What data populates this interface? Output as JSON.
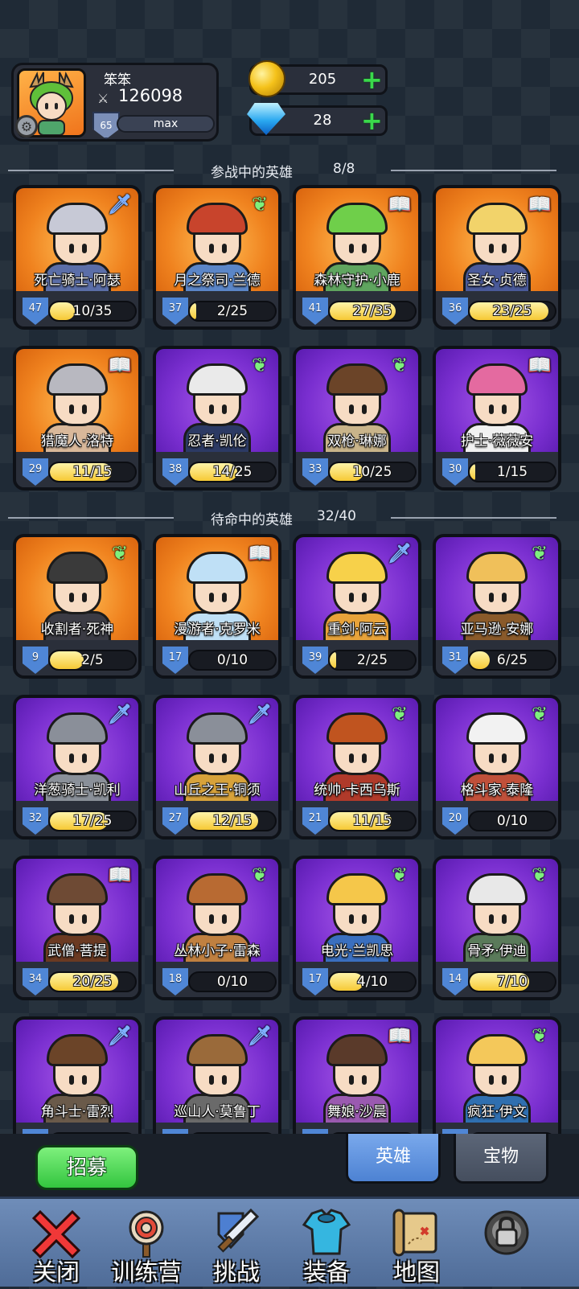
{
  "player": {
    "name": "笨笨",
    "power": "126098",
    "level": "65",
    "level_status": "max"
  },
  "currency": {
    "gold": "205",
    "gems": "28"
  },
  "active_section": {
    "title": "参战中的英雄",
    "count": "8/8"
  },
  "standby_section": {
    "title": "待命中的英雄",
    "count": "32/40"
  },
  "active_heroes": [
    {
      "name": "死亡骑士·阿瑟",
      "level": "47",
      "progress": "10/35",
      "fill": 0.29,
      "bg": "orange",
      "class_icon": "sword-icon"
    },
    {
      "name": "月之祭司·兰德",
      "level": "37",
      "progress": "2/25",
      "fill": 0.08,
      "bg": "orange",
      "class_icon": "wing-icon"
    },
    {
      "name": "森林守护·小鹿",
      "level": "41",
      "progress": "27/35",
      "fill": 0.77,
      "bg": "orange",
      "class_icon": "book-icon"
    },
    {
      "name": "圣女·贞德",
      "level": "36",
      "progress": "23/25",
      "fill": 0.92,
      "bg": "orange",
      "class_icon": "book-icon"
    },
    {
      "name": "猎魔人·洛特",
      "level": "29",
      "progress": "11/15",
      "fill": 0.73,
      "bg": "orange",
      "class_icon": "book-icon"
    },
    {
      "name": "忍者·凯伦",
      "level": "38",
      "progress": "14/25",
      "fill": 0.56,
      "bg": "purple",
      "class_icon": "wing-icon"
    },
    {
      "name": "双枪·琳娜",
      "level": "33",
      "progress": "10/25",
      "fill": 0.4,
      "bg": "purple",
      "class_icon": "wing-icon"
    },
    {
      "name": "护士·薇薇安",
      "level": "30",
      "progress": "1/15",
      "fill": 0.07,
      "bg": "purple",
      "class_icon": "book-icon"
    }
  ],
  "standby_heroes": [
    {
      "name": "收割者·死神",
      "level": "9",
      "progress": "2/5",
      "fill": 0.4,
      "bg": "orange",
      "class_icon": "wing-icon"
    },
    {
      "name": "漫游者·克罗米",
      "level": "17",
      "progress": "0/10",
      "fill": 0.0,
      "bg": "orange",
      "class_icon": "book-icon"
    },
    {
      "name": "重剑·阿云",
      "level": "39",
      "progress": "2/25",
      "fill": 0.08,
      "bg": "purple",
      "class_icon": "sword-icon"
    },
    {
      "name": "亚马逊·安娜",
      "level": "31",
      "progress": "6/25",
      "fill": 0.24,
      "bg": "purple",
      "class_icon": "wing-icon"
    },
    {
      "name": "洋葱骑士·凯利",
      "level": "32",
      "progress": "17/25",
      "fill": 0.68,
      "bg": "purple",
      "class_icon": "sword-icon"
    },
    {
      "name": "山丘之王·铜须",
      "level": "27",
      "progress": "12/15",
      "fill": 0.8,
      "bg": "purple",
      "class_icon": "sword-icon"
    },
    {
      "name": "统帅·卡西乌斯",
      "level": "21",
      "progress": "11/15",
      "fill": 0.73,
      "bg": "purple",
      "class_icon": "wing-icon"
    },
    {
      "name": "格斗家·泰隆",
      "level": "20",
      "progress": "0/10",
      "fill": 0.0,
      "bg": "purple",
      "class_icon": "wing-icon"
    },
    {
      "name": "武僧·菩提",
      "level": "34",
      "progress": "20/25",
      "fill": 0.8,
      "bg": "purple",
      "class_icon": "book-icon"
    },
    {
      "name": "丛林小子·雷森",
      "level": "18",
      "progress": "0/10",
      "fill": 0.0,
      "bg": "purple",
      "class_icon": "wing-icon"
    },
    {
      "name": "电光·兰凯思",
      "level": "17",
      "progress": "4/10",
      "fill": 0.4,
      "bg": "purple",
      "class_icon": "wing-icon"
    },
    {
      "name": "骨矛·伊迪",
      "level": "14",
      "progress": "7/10",
      "fill": 0.7,
      "bg": "purple",
      "class_icon": "wing-icon"
    },
    {
      "name": "角斗士·雷烈",
      "level": "",
      "progress": "",
      "fill": 0.0,
      "bg": "purple",
      "class_icon": "sword-icon"
    },
    {
      "name": "巡山人·莫鲁丁",
      "level": "",
      "progress": "",
      "fill": 0.0,
      "bg": "purple",
      "class_icon": "sword-icon"
    },
    {
      "name": "舞娘·沙晨",
      "level": "",
      "progress": "",
      "fill": 0.0,
      "bg": "purple",
      "class_icon": "book-icon"
    },
    {
      "name": "疯狂·伊文",
      "level": "",
      "progress": "",
      "fill": 0.0,
      "bg": "purple",
      "class_icon": "wing-icon"
    }
  ],
  "actions": {
    "recruit": "招募",
    "tab_heroes": "英雄",
    "tab_treasure": "宝物"
  },
  "nav": [
    {
      "label": "关闭",
      "icon": "close-icon",
      "selected": true
    },
    {
      "label": "训练营",
      "icon": "target-icon",
      "selected": false
    },
    {
      "label": "挑战",
      "icon": "sword-shield-icon",
      "selected": false
    },
    {
      "label": "装备",
      "icon": "armor-icon",
      "selected": false
    },
    {
      "label": "地图",
      "icon": "map-icon",
      "selected": false
    },
    {
      "label": "",
      "icon": "locked-icon",
      "selected": false
    }
  ],
  "colors": {
    "orange_card": "#f0831f",
    "purple_card": "#7a2fd0",
    "progress_fill": "#f6c935",
    "level_shield": "#4f86d6",
    "plus_green": "#3ad94b",
    "active_tab": "#5b8fdc"
  }
}
